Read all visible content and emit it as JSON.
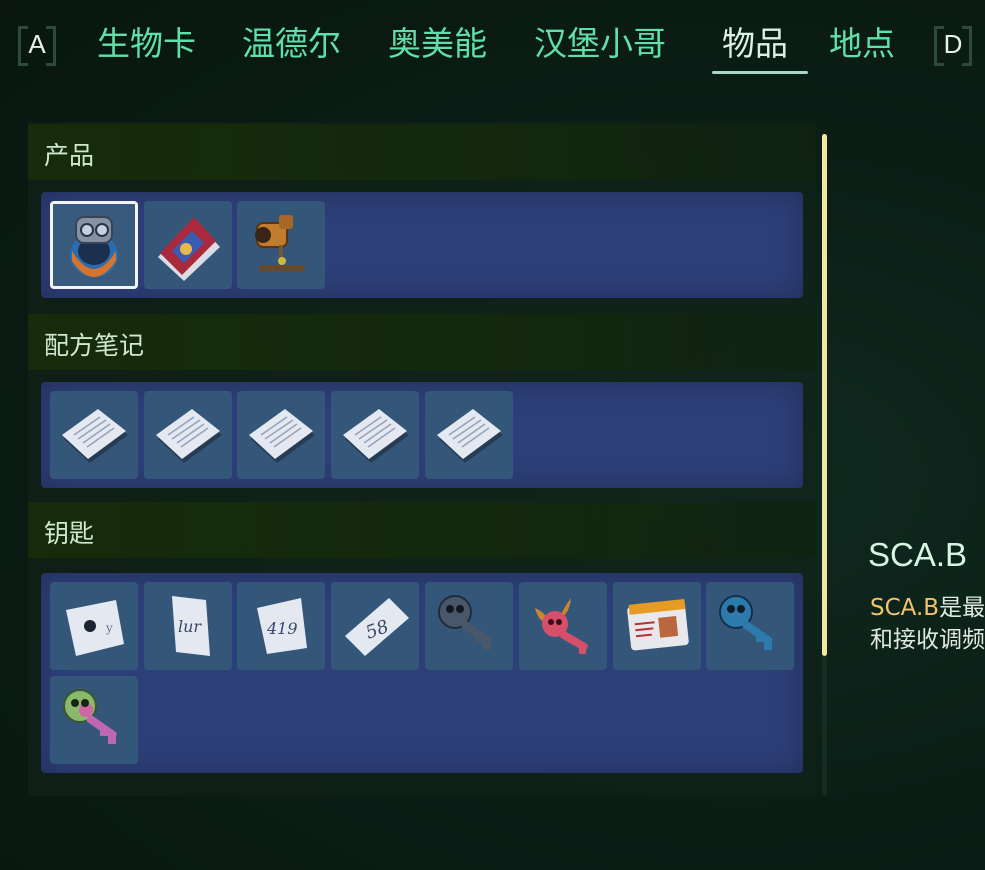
{
  "nav": {
    "left_hint": "A",
    "right_hint": "D",
    "tabs": [
      {
        "label": "生物卡"
      },
      {
        "label": "温德尔"
      },
      {
        "label": "奥美能"
      },
      {
        "label": "汉堡小哥"
      },
      {
        "label": "物品",
        "active": true
      },
      {
        "label": "地点"
      }
    ]
  },
  "sections": [
    {
      "label": "产品",
      "items": [
        {
          "icon": "ring-device-icon",
          "selected": true
        },
        {
          "icon": "magazine-icon"
        },
        {
          "icon": "periscope-icon"
        }
      ]
    },
    {
      "label": "配方笔记",
      "items": [
        {
          "icon": "paper-note-icon"
        },
        {
          "icon": "paper-note-icon"
        },
        {
          "icon": "paper-note-icon"
        },
        {
          "icon": "paper-note-icon"
        },
        {
          "icon": "paper-note-icon"
        }
      ]
    },
    {
      "label": "钥匙",
      "items": [
        {
          "icon": "note-fragment-icon",
          "scrawl": "y"
        },
        {
          "icon": "note-fragment-icon",
          "scrawl": "lur"
        },
        {
          "icon": "note-fragment-icon",
          "scrawl": "419"
        },
        {
          "icon": "note-fragment-icon",
          "scrawl": "58"
        },
        {
          "icon": "skull-key-icon",
          "color": "#4a5a6a"
        },
        {
          "icon": "horned-key-icon",
          "color": "#e0506a"
        },
        {
          "icon": "id-card-icon"
        },
        {
          "icon": "skull-key-icon",
          "color": "#2e7fb0"
        },
        {
          "icon": "skull-key-icon",
          "color": "#8fc06a"
        }
      ]
    }
  ],
  "detail": {
    "title": "SCA.B",
    "desc_highlight": "SCA.B",
    "desc_line1_rest": "是最",
    "desc_line2": "和接收调频"
  },
  "colors": {
    "tab_text": "#5fe0a8",
    "tab_active": "#d9f2e2",
    "grid_bg": "#2d3f78",
    "slot_bg": "#34587a",
    "highlight": "#f2c46b",
    "scrollbar": "#f3e7a0"
  }
}
